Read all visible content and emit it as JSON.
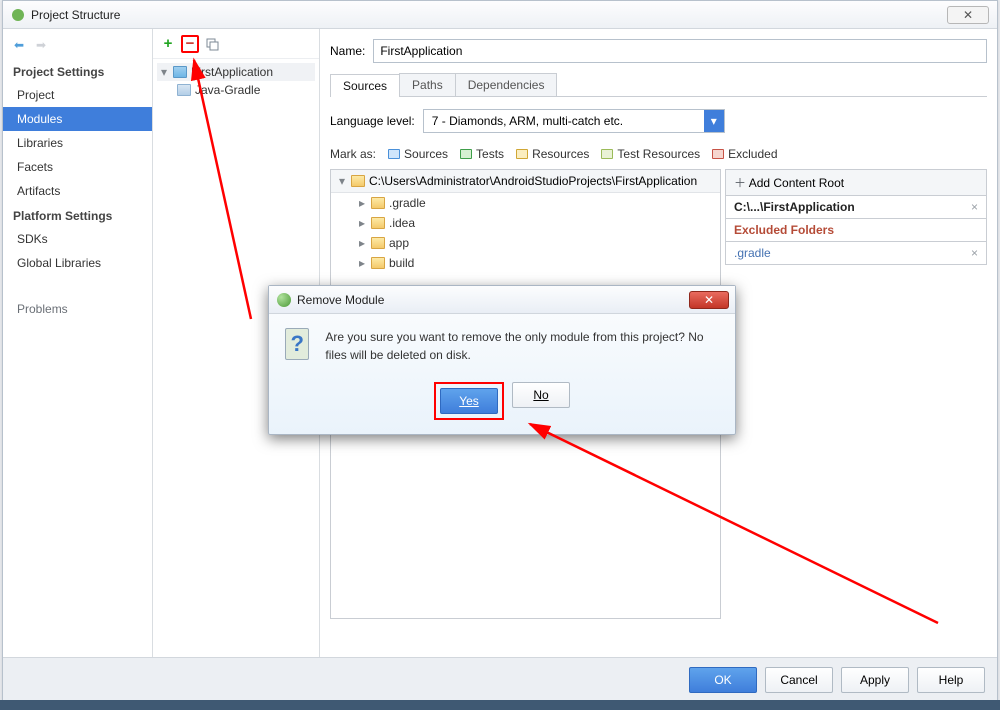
{
  "window": {
    "title": "Project Structure",
    "close_symbol": "✕"
  },
  "ghost_menu": "…",
  "sidebar": {
    "section1": "Project Settings",
    "items1": [
      "Project",
      "Modules",
      "Libraries",
      "Facets",
      "Artifacts"
    ],
    "section2": "Platform Settings",
    "items2": [
      "SDKs",
      "Global Libraries"
    ],
    "problems": "Problems"
  },
  "middle": {
    "app": "FirstApplication",
    "sub": "Java-Gradle"
  },
  "content": {
    "name_label": "Name:",
    "name_value": "FirstApplication",
    "tabs": [
      "Sources",
      "Paths",
      "Dependencies"
    ],
    "lang_label": "Language level:",
    "lang_value": "7 - Diamonds, ARM, multi-catch etc.",
    "mark_label": "Mark as:",
    "marks": [
      "Sources",
      "Tests",
      "Resources",
      "Test Resources",
      "Excluded"
    ],
    "root_path": "C:\\Users\\Administrator\\AndroidStudioProjects\\FirstApplication",
    "children": [
      ".gradle",
      ".idea",
      "app",
      "build"
    ],
    "add_content_root": "Add Content Root",
    "content_root": "C:\\...\\FirstApplication",
    "excluded_label": "Excluded Folders",
    "excluded_item": ".gradle"
  },
  "footer": {
    "ok": "OK",
    "cancel": "Cancel",
    "apply": "Apply",
    "help": "Help"
  },
  "modal": {
    "title": "Remove Module",
    "message": "Are you sure you want to remove the only module from this project? No files will be deleted on disk.",
    "yes": "Yes",
    "no": "No"
  }
}
